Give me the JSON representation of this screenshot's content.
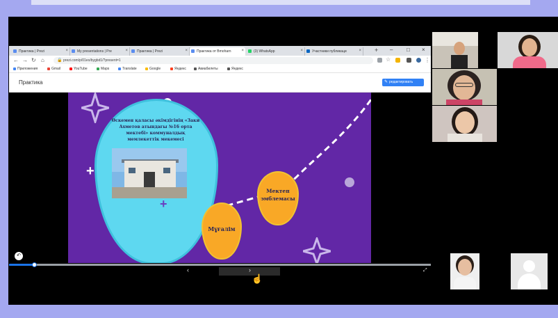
{
  "browser": {
    "tabs": [
      {
        "label": "Практика | Prezi"
      },
      {
        "label": "My presentations | Pre"
      },
      {
        "label": "Практика | Prezi"
      },
      {
        "label": "Практика от Bmoharn"
      },
      {
        "label": "(3) WhatsApp"
      },
      {
        "label": "Участники публикаци"
      }
    ],
    "url": "prezi.com/p/01eo/bygbd1/?present=1",
    "bookmarks": [
      "Приложения",
      "Gmail",
      "YouTube",
      "Maps",
      "Translate",
      "Google",
      "Яндекс",
      "Авиабилеты",
      "Яндекс"
    ]
  },
  "prezi": {
    "title": "Практика",
    "edit_button": "редактировать"
  },
  "slide": {
    "balloon_text": "Өскемен қаласы әкімдігінің «Заки Ахметов атындағы №16 орта мектебі» коммуналдық мемлекеттік мекемесі",
    "mektep_label": "Мектеп эмблемасы",
    "mugalim_label": "Мұғалім"
  },
  "player": {
    "progress_percent": 6
  },
  "participants": [
    {
      "tile": "camera-1"
    },
    {
      "tile": "camera-2"
    },
    {
      "tile": "camera-3"
    },
    {
      "tile": "camera-4"
    },
    {
      "tile": "camera-5"
    },
    {
      "tile": "no-camera-avatar"
    }
  ]
}
